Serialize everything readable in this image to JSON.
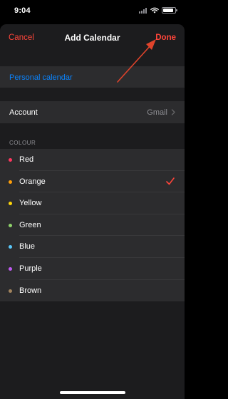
{
  "status": {
    "time": "9:04",
    "battery_level": 0.85
  },
  "nav": {
    "cancel_label": "Cancel",
    "title": "Add Calendar",
    "done_label": "Done"
  },
  "calendar_name": {
    "value": "Personal calendar"
  },
  "account": {
    "label": "Account",
    "value": "Gmail"
  },
  "colour_section": {
    "header": "COLOUR",
    "selected": "Orange",
    "options": [
      {
        "label": "Red",
        "color": "#ff375f"
      },
      {
        "label": "Orange",
        "color": "#ff9f0a"
      },
      {
        "label": "Yellow",
        "color": "#ffd60a"
      },
      {
        "label": "Green",
        "color": "#8fd36b"
      },
      {
        "label": "Blue",
        "color": "#5ac8fa"
      },
      {
        "label": "Purple",
        "color": "#bf5af2"
      },
      {
        "label": "Brown",
        "color": "#a2845e"
      }
    ]
  },
  "colors": {
    "accent": "#ff453a",
    "link": "#0a84ff",
    "annotation_arrow": "#e0432b"
  },
  "icons": {
    "signal": "cellular-signal-icon",
    "wifi": "wifi-icon",
    "battery": "battery-icon",
    "account_chevron": "chevron-right-icon",
    "selected_mark": "checkmark-icon"
  }
}
